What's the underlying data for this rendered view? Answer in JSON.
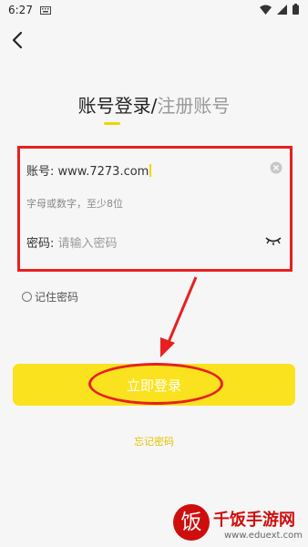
{
  "status_bar": {
    "time": "6:27"
  },
  "header": {
    "title_login": "账号登录",
    "title_separator": "/",
    "title_register": "注册账号"
  },
  "form": {
    "account_label": "账号:",
    "account_value": "www.7273.com",
    "account_hint": "字母或数字，至少8位",
    "password_label": "密码:",
    "password_placeholder": "请输入密码"
  },
  "remember_label": "记住密码",
  "login_button": "立即登录",
  "forgot_link": "忘记密码",
  "watermark": {
    "logo_char": "饭",
    "name": "千饭手游网",
    "url": "www.eduext.com"
  },
  "colors": {
    "accent": "#fbe21e",
    "annotation_red": "#e62020",
    "watermark_red": "#cf0d0d"
  }
}
